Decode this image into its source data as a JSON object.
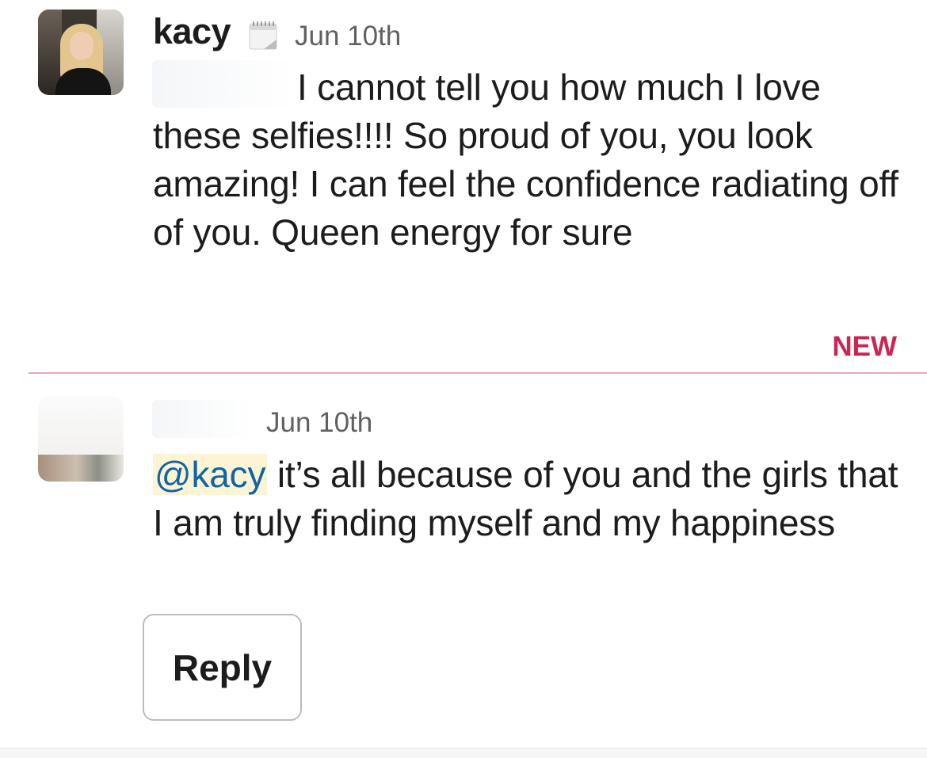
{
  "messages": [
    {
      "username": "kacy",
      "status_emoji": "calendar-icon",
      "timestamp": "Jun 10th",
      "text_line1": "I cannot tell you how much I love",
      "text_rest": "these selfies!!!! So proud of you, you look amazing! I can feel the confidence radiating off of you. Queen energy for sure"
    },
    {
      "username": "",
      "timestamp": "Jun 10th",
      "mention": "@kacy",
      "text": " it’s all because of you and the girls that I am truly finding myself and my happiness"
    }
  ],
  "divider": {
    "label": "NEW",
    "color": "#cd2553"
  },
  "reply_button": {
    "label": "Reply"
  }
}
